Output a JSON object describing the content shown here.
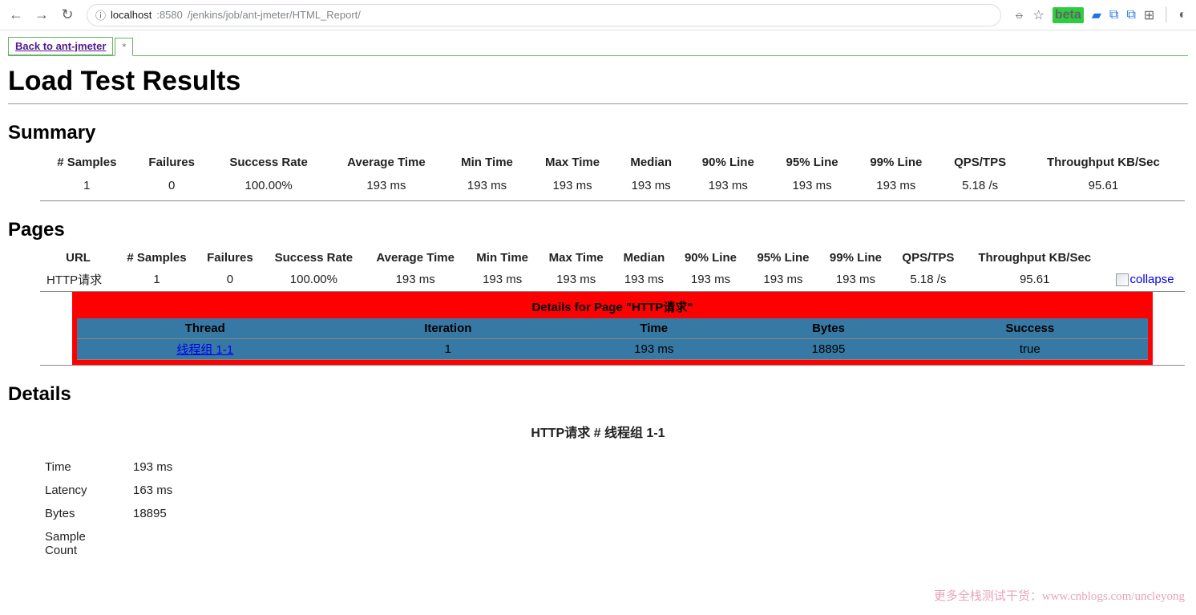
{
  "browser": {
    "url_prefix": "localhost",
    "url_port": ":8580",
    "url_path": "/jenkins/job/ant-jmeter/HTML_Report/"
  },
  "tabs": {
    "back_label": "Back to ant-jmeter",
    "active_label": "*"
  },
  "title": "Load Test Results",
  "sections": {
    "summary": "Summary",
    "pages": "Pages",
    "details": "Details"
  },
  "summary_headers": [
    "# Samples",
    "Failures",
    "Success Rate",
    "Average Time",
    "Min Time",
    "Max Time",
    "Median",
    "90% Line",
    "95% Line",
    "99% Line",
    "QPS/TPS",
    "Throughput KB/Sec"
  ],
  "summary_row": [
    "1",
    "0",
    "100.00%",
    "193 ms",
    "193 ms",
    "193 ms",
    "193 ms",
    "193 ms",
    "193 ms",
    "193 ms",
    "5.18 /s",
    "95.61"
  ],
  "pages_headers": [
    "URL",
    "# Samples",
    "Failures",
    "Success Rate",
    "Average Time",
    "Min Time",
    "Max Time",
    "Median",
    "90% Line",
    "95% Line",
    "99% Line",
    "QPS/TPS",
    "Throughput KB/Sec"
  ],
  "pages_row": [
    "HTTP请求",
    "1",
    "0",
    "100.00%",
    "193 ms",
    "193 ms",
    "193 ms",
    "193 ms",
    "193 ms",
    "193 ms",
    "193 ms",
    "5.18 /s",
    "95.61"
  ],
  "collapse_label": "collapse",
  "details_box": {
    "title": "Details for Page \"HTTP请求\"",
    "headers": [
      "Thread",
      "Iteration",
      "Time",
      "Bytes",
      "Success"
    ],
    "row": {
      "thread": "线程组 1-1",
      "iteration": "1",
      "time": "193 ms",
      "bytes": "18895",
      "success": "true"
    }
  },
  "detail_heading": "HTTP请求 # 线程组 1-1",
  "detail_kv": [
    {
      "k": "Time",
      "v": "193 ms"
    },
    {
      "k": "Latency",
      "v": "163 ms"
    },
    {
      "k": "Bytes",
      "v": "18895"
    },
    {
      "k": "Sample Count",
      "v": ""
    }
  ],
  "watermark": "更多全栈测试干货：www.cnblogs.com/uncleyong"
}
